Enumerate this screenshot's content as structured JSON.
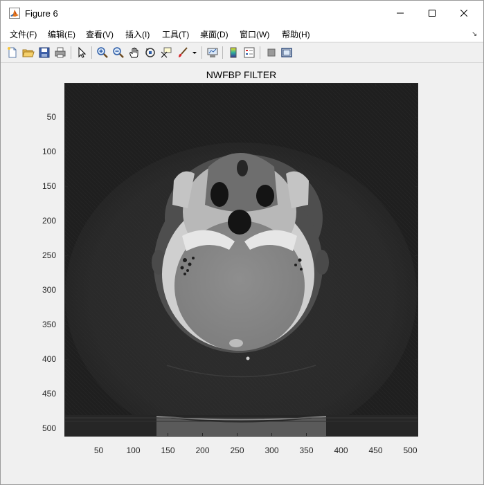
{
  "window": {
    "title": "Figure 6",
    "icon": "matlab-icon"
  },
  "menu": [
    {
      "label": "文件(F)"
    },
    {
      "label": "编辑(E)"
    },
    {
      "label": "查看(V)"
    },
    {
      "label": "插入(I)"
    },
    {
      "label": "工具(T)"
    },
    {
      "label": "桌面(D)"
    },
    {
      "label": "窗口(W)"
    },
    {
      "label": "帮助(H)"
    }
  ],
  "toolbar": [
    {
      "icon": "new-figure-icon"
    },
    {
      "icon": "open-file-icon"
    },
    {
      "icon": "save-icon"
    },
    {
      "icon": "print-icon"
    },
    {
      "icon": "edit-plot-icon"
    },
    {
      "icon": "zoom-in-icon"
    },
    {
      "icon": "zoom-out-icon"
    },
    {
      "icon": "pan-icon"
    },
    {
      "icon": "rotate-3d-icon"
    },
    {
      "icon": "data-cursor-icon"
    },
    {
      "icon": "brush-icon"
    },
    {
      "icon": "link-plot-icon"
    },
    {
      "icon": "insert-colorbar-icon"
    },
    {
      "icon": "insert-legend-icon"
    },
    {
      "icon": "hide-plot-tools-icon"
    },
    {
      "icon": "show-plot-tools-icon"
    }
  ],
  "axes": {
    "title": "NWFBP FILTER",
    "x_ticks": [
      "50",
      "100",
      "150",
      "200",
      "250",
      "300",
      "350",
      "400",
      "450",
      "500"
    ],
    "y_ticks": [
      "50",
      "100",
      "150",
      "200",
      "250",
      "300",
      "350",
      "400",
      "450",
      "500"
    ],
    "x_range": [
      0.5,
      512.5
    ],
    "y_range": [
      0.5,
      512.5
    ],
    "colormap": "gray",
    "image": "axial-head-ct-reconstruction"
  }
}
